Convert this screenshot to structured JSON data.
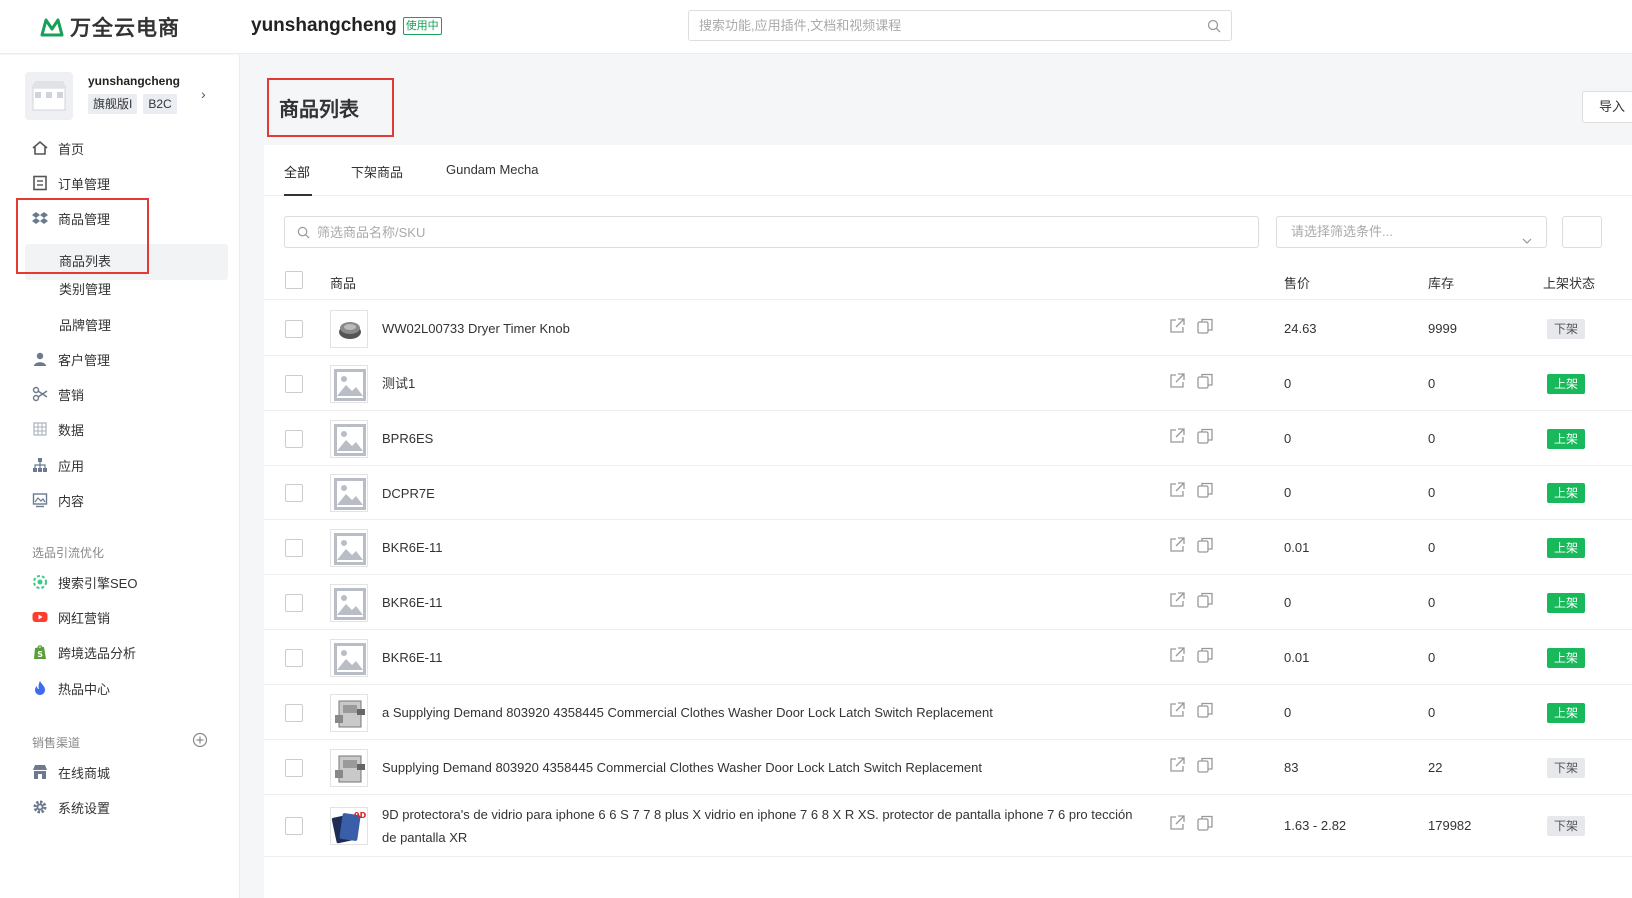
{
  "header": {
    "logo_text": "万全云电商",
    "shop_name": "yunshangcheng",
    "shop_status": "使用中",
    "search_placeholder": "搜索功能,应用插件,文档和视频课程"
  },
  "store": {
    "name": "yunshangcheng",
    "tags": [
      "旗舰版I",
      "B2C"
    ]
  },
  "sidebar": {
    "items": [
      {
        "label": "首页",
        "icon": "home-icon"
      },
      {
        "label": "订单管理",
        "icon": "order-icon"
      },
      {
        "label": "商品管理",
        "icon": "dropbox-icon"
      },
      {
        "label": "客户管理",
        "icon": "user-icon"
      },
      {
        "label": "营销",
        "icon": "marketing-icon"
      },
      {
        "label": "数据",
        "icon": "data-icon"
      },
      {
        "label": "应用",
        "icon": "sitemap-icon"
      },
      {
        "label": "内容",
        "icon": "picture-icon"
      }
    ],
    "product_sub": [
      "商品列表",
      "类别管理",
      "品牌管理"
    ],
    "section_seo": "选品引流优化",
    "seo_items": [
      {
        "label": "搜索引擎SEO",
        "icon": "seo-icon"
      },
      {
        "label": "网红营销",
        "icon": "youtube-icon"
      },
      {
        "label": "跨境选品分析",
        "icon": "shopify-icon"
      },
      {
        "label": "热品中心",
        "icon": "fire-icon"
      }
    ],
    "section_channels": "销售渠道",
    "channel_items": [
      {
        "label": "在线商城",
        "icon": "store-icon"
      },
      {
        "label": "系统设置",
        "icon": "gear-icon"
      }
    ]
  },
  "page": {
    "title": "商品列表",
    "import_label": "导入"
  },
  "tabs": [
    "全部",
    "下架商品",
    "Gundam Mecha"
  ],
  "filter": {
    "search_placeholder": "筛选商品名称/SKU",
    "select_placeholder": "请选择筛选条件..."
  },
  "table": {
    "columns": [
      "商品",
      "售价",
      "库存",
      "上架状态"
    ],
    "rows": [
      {
        "name": "WW02L00733 Dryer Timer Knob",
        "price": "24.63",
        "stock": "9999",
        "status": "下架",
        "thumb": "knob"
      },
      {
        "name": "测试1",
        "price": "0",
        "stock": "0",
        "status": "上架",
        "thumb": "placeholder"
      },
      {
        "name": "BPR6ES",
        "price": "0",
        "stock": "0",
        "status": "上架",
        "thumb": "placeholder"
      },
      {
        "name": "DCPR7E",
        "price": "0",
        "stock": "0",
        "status": "上架",
        "thumb": "placeholder"
      },
      {
        "name": "BKR6E-11",
        "price": "0.01",
        "stock": "0",
        "status": "上架",
        "thumb": "placeholder"
      },
      {
        "name": "BKR6E-11",
        "price": "0",
        "stock": "0",
        "status": "上架",
        "thumb": "placeholder"
      },
      {
        "name": "BKR6E-11",
        "price": "0.01",
        "stock": "0",
        "status": "上架",
        "thumb": "placeholder"
      },
      {
        "name": "a Supplying Demand 803920 4358445 Commercial Clothes Washer Door Lock Latch Switch Replacement",
        "price": "0",
        "stock": "0",
        "status": "上架",
        "thumb": "latch"
      },
      {
        "name": "Supplying Demand 803920 4358445 Commercial Clothes Washer Door Lock Latch Switch Replacement",
        "price": "83",
        "stock": "22",
        "status": "下架",
        "thumb": "latch"
      },
      {
        "name": "9D protectora's de vidrio para iphone 6 6 S 7 7 8 plus X vidrio en iphone 7 6 8 X R XS. protector de pantalla iphone 7 6 pro tección de pantalla XR",
        "price": "1.63 - 2.82",
        "stock": "179982",
        "status": "下架",
        "thumb": "glass",
        "thumb_text": "9D"
      }
    ]
  },
  "colors": {
    "brand": "#18a058",
    "status_on": "#18b95a",
    "status_off": "#e6e8eb",
    "highlight": "#e53935"
  }
}
